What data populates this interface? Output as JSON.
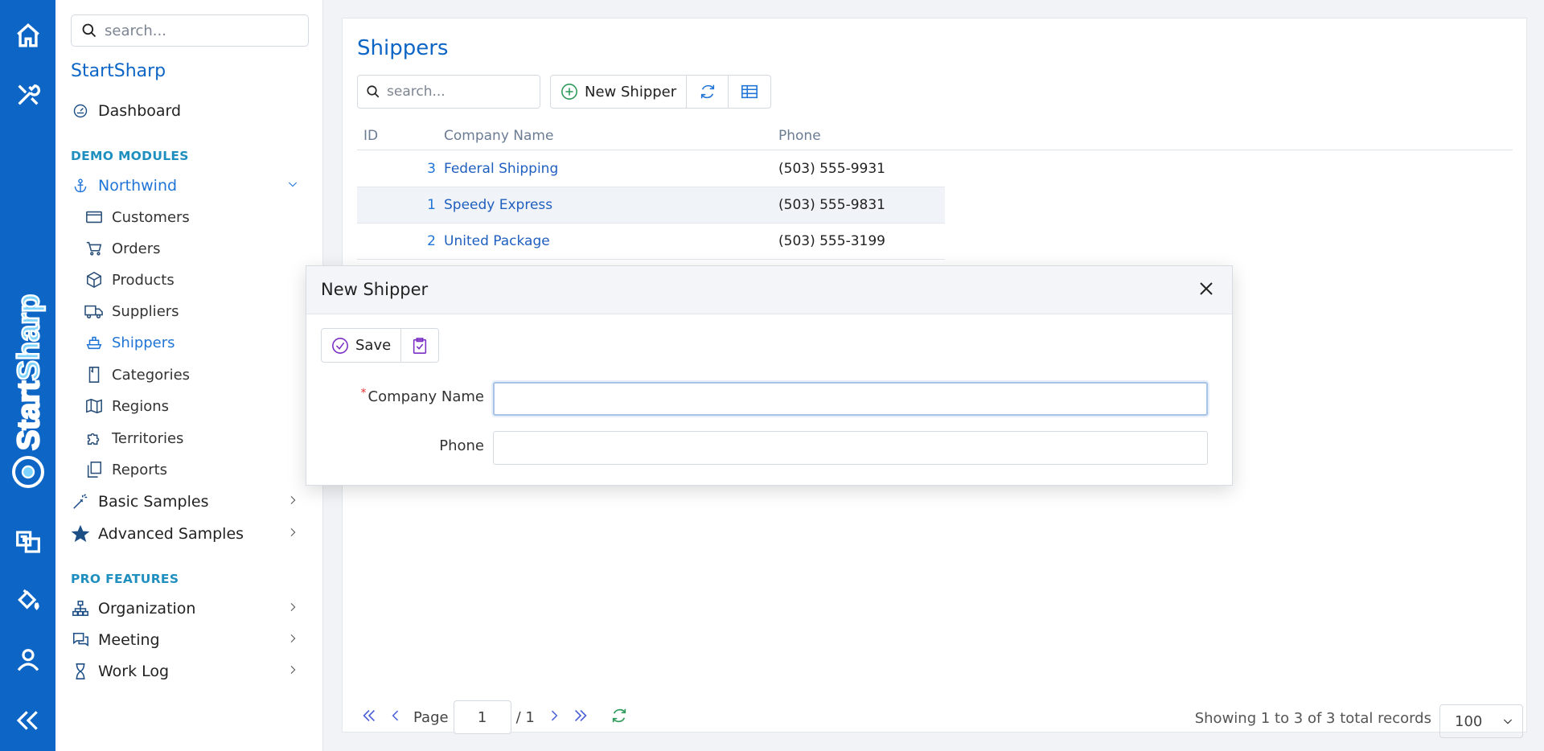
{
  "colors": {
    "rail": "#0d65c6",
    "accent": "#1f74d6",
    "section": "#1f8fbf"
  },
  "rail": {
    "items": [
      "home-icon",
      "tools-icon",
      "translate-icon",
      "paint-bucket-icon",
      "user-icon",
      "collapse-icon"
    ],
    "brand": "StartSharp"
  },
  "sidebar": {
    "search_placeholder": "search...",
    "app_title": "StartSharp",
    "dashboard": "Dashboard",
    "section_demo": "DEMO MODULES",
    "northwind": "Northwind",
    "sub_items": [
      {
        "label": "Customers",
        "icon": "credit-card-icon"
      },
      {
        "label": "Orders",
        "icon": "cart-icon"
      },
      {
        "label": "Products",
        "icon": "box-icon"
      },
      {
        "label": "Suppliers",
        "icon": "truck-icon"
      },
      {
        "label": "Shippers",
        "icon": "ship-icon"
      },
      {
        "label": "Categories",
        "icon": "bookmark-icon"
      },
      {
        "label": "Regions",
        "icon": "map-icon"
      },
      {
        "label": "Territories",
        "icon": "puzzle-icon"
      },
      {
        "label": "Reports",
        "icon": "copy-icon"
      }
    ],
    "basic_samples": "Basic Samples",
    "advanced_samples": "Advanced Samples",
    "section_pro": "PRO FEATURES",
    "organization": "Organization",
    "meeting": "Meeting",
    "work_log": "Work Log"
  },
  "main": {
    "title": "Shippers",
    "search_placeholder": "search...",
    "new_button": "New Shipper",
    "columns": [
      "ID",
      "Company Name",
      "Phone"
    ],
    "rows": [
      {
        "id": "3",
        "company": "Federal Shipping",
        "phone": "(503) 555-9931"
      },
      {
        "id": "1",
        "company": "Speedy Express",
        "phone": "(503) 555-9831"
      },
      {
        "id": "2",
        "company": "United Package",
        "phone": "(503) 555-3199"
      }
    ],
    "pager": {
      "page_label": "Page",
      "page_value": "1",
      "page_total": "/ 1",
      "records": "Showing 1 to 3 of 3 total records",
      "page_size": "100"
    }
  },
  "dialog": {
    "title": "New Shipper",
    "save": "Save",
    "required_mark": "*",
    "company_label": "Company Name",
    "company_value": "",
    "phone_label": "Phone",
    "phone_value": ""
  }
}
